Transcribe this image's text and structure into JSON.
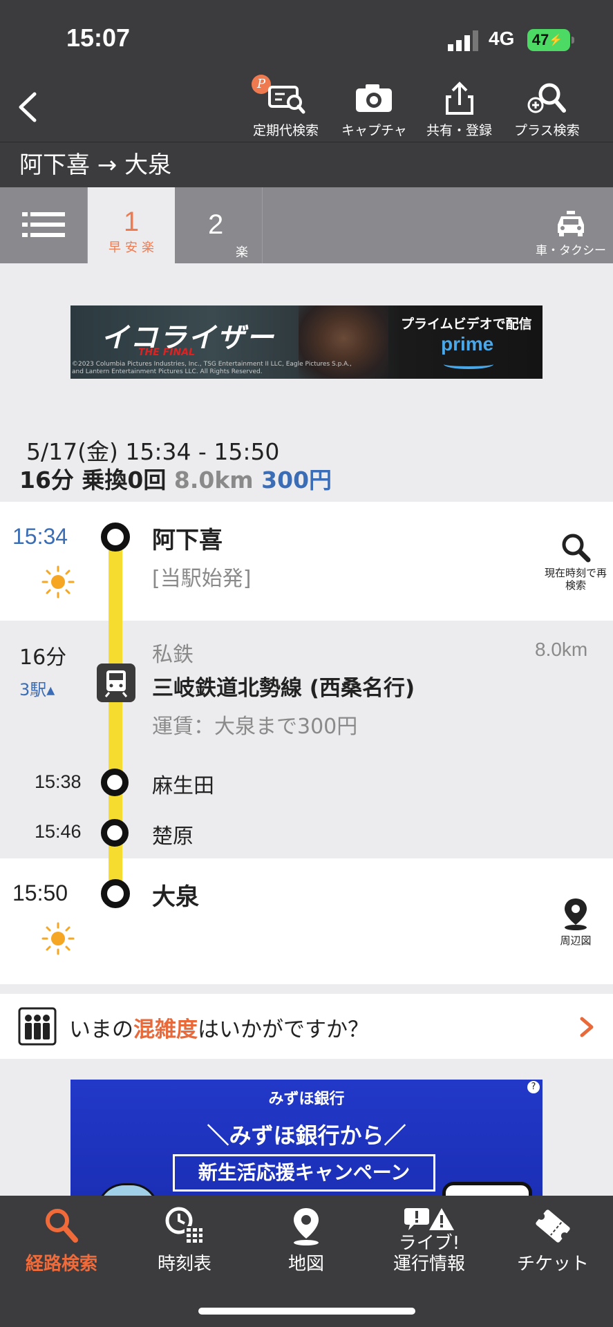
{
  "status": {
    "time": "15:07",
    "network": "4G",
    "battery": "47"
  },
  "header": {
    "tools": [
      {
        "label": "定期代検索",
        "icon": "commuter-pass-icon"
      },
      {
        "label": "キャプチャ",
        "icon": "camera-icon"
      },
      {
        "label": "共有・登録",
        "icon": "share-icon"
      },
      {
        "label": "プラス検索",
        "icon": "plus-search-icon"
      }
    ],
    "badge": "P"
  },
  "route_title": "阿下喜 → 大泉",
  "tabs": {
    "tab1_num": "1",
    "tab1_tags": "早安楽",
    "tab2_num": "2",
    "tab2_tag": "楽",
    "taxi_label": "車・タクシー"
  },
  "ad1": {
    "title": "イコライザー",
    "subtitle": "THE FINAL",
    "fine": "©2023 Columbia Pictures Industries, Inc., TSG Entertainment II LLC, Eagle Pictures S.p.A., and Lantern Entertainment Pictures LLC. All Rights Reserved.",
    "prime_text": "プライムビデオで配信",
    "prime": "prime"
  },
  "summary": {
    "datetime": "5/17(金) 15:34 - 15:50",
    "duration_transfer": "16分 乗換0回",
    "distance": "8.0km",
    "fare": "300円"
  },
  "itinerary": {
    "origin": {
      "time": "15:34",
      "station": "阿下喜",
      "note": "[当駅始発]",
      "action": "現在時刻で再検索"
    },
    "segment": {
      "duration": "16分",
      "stops": "3駅▴",
      "type": "私鉄",
      "distance": "8.0km",
      "line": "三岐鉄道北勢線 (西桑名行)",
      "fare": "運賃：大泉まで300円"
    },
    "intermediate": [
      {
        "time": "15:38",
        "station": "麻生田"
      },
      {
        "time": "15:46",
        "station": "楚原"
      }
    ],
    "destination": {
      "time": "15:50",
      "station": "大泉",
      "action": "周辺図"
    }
  },
  "congestion": {
    "pre": "いまの",
    "highlight": "混雑度",
    "post": "はいかがですか？"
  },
  "ad2": {
    "bank": "みずほ銀行",
    "line1": "＼みずほ銀行から／",
    "banner": "新生活応援キャンペーン",
    "help": "?"
  },
  "bottom_nav": [
    {
      "label": "経路検索",
      "icon": "route-search-icon",
      "active": true
    },
    {
      "label": "時刻表",
      "icon": "timetable-icon",
      "active": false
    },
    {
      "label": "地図",
      "icon": "map-pin-icon",
      "active": false
    },
    {
      "label": "ライブ!\n運行情報",
      "icon": "live-info-icon",
      "active": false
    },
    {
      "label": "チケット",
      "icon": "ticket-icon",
      "active": false
    }
  ],
  "colors": {
    "accent": "#f07a4f",
    "blue": "#3a6db5",
    "line": "#f5dc2e",
    "dark": "#3c3c3f"
  }
}
